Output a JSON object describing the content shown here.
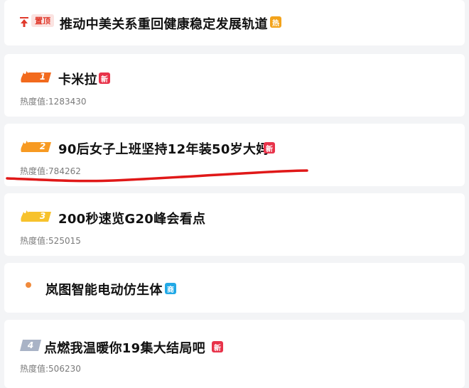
{
  "pinned": {
    "tag": "置顶",
    "title": "推动中美关系重回健康稳定发展轨道",
    "badge": "热",
    "badge_color": "#f3a31b"
  },
  "heat_label": "热度值:",
  "items": [
    {
      "rank": "1",
      "title": "卡米拉",
      "heat": "1283430",
      "badge": "新",
      "badge_color": "#e8334a",
      "rank_color": "#f26a1d"
    },
    {
      "rank": "2",
      "title": "90后女子上班坚持12年装50岁大妈",
      "heat": "784262",
      "badge": "新",
      "badge_color": "#e8334a",
      "rank_color": "#f79a22"
    },
    {
      "rank": "3",
      "title": "200秒速览G20峰会看点",
      "heat": "525015",
      "rank_color": "#f7c22c"
    },
    {
      "title": "岚图智能电动仿生体",
      "badge": "商",
      "badge_color": "#23a9e6"
    },
    {
      "rank": "4",
      "title": "点燃我温暖你19集大结局吧",
      "heat": "506230",
      "badge": "新",
      "badge_color": "#e8334a",
      "rank_color": "#a9b3c6"
    }
  ],
  "colors": {
    "page_bg": "#f3f4f6",
    "card_bg": "#ffffff",
    "annotation_red": "#e01818"
  }
}
